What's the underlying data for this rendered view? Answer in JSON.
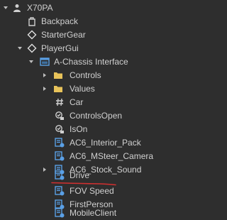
{
  "explorer": {
    "rows": [
      {
        "label": "X70PA",
        "icon": "player-icon"
      },
      {
        "label": "Backpack",
        "icon": "backpack-icon"
      },
      {
        "label": "StarterGear",
        "icon": "startergear-icon"
      },
      {
        "label": "PlayerGui",
        "icon": "playergui-icon"
      },
      {
        "label": "A-Chassis Interface",
        "icon": "screengui-icon"
      },
      {
        "label": "Controls",
        "icon": "folder-icon"
      },
      {
        "label": "Values",
        "icon": "folder-icon"
      },
      {
        "label": "Car",
        "icon": "objectvalue-icon"
      },
      {
        "label": "ControlsOpen",
        "icon": "boolvalue-icon"
      },
      {
        "label": "IsOn",
        "icon": "boolvalue-icon"
      },
      {
        "label": "AC6_Interior_Pack",
        "icon": "localscript-icon"
      },
      {
        "label": "AC6_MSteer_Camera",
        "icon": "localscript-icon"
      },
      {
        "label": "AC6_Stock_Sound",
        "icon": "localscript-icon"
      },
      {
        "label": "Drive",
        "icon": "localscript-icon"
      },
      {
        "label": "FOV Speed",
        "icon": "localscript-icon"
      },
      {
        "label": "FirstPerson",
        "icon": "localscript-icon"
      },
      {
        "label": "MobileClient",
        "icon": "localscript-icon"
      }
    ]
  },
  "colors": {
    "background": "#2e2e2e",
    "text": "#d0d0d0",
    "folder": "#e8c35a",
    "script_blue": "#5aa0e6",
    "annotation_red": "#d23030"
  }
}
